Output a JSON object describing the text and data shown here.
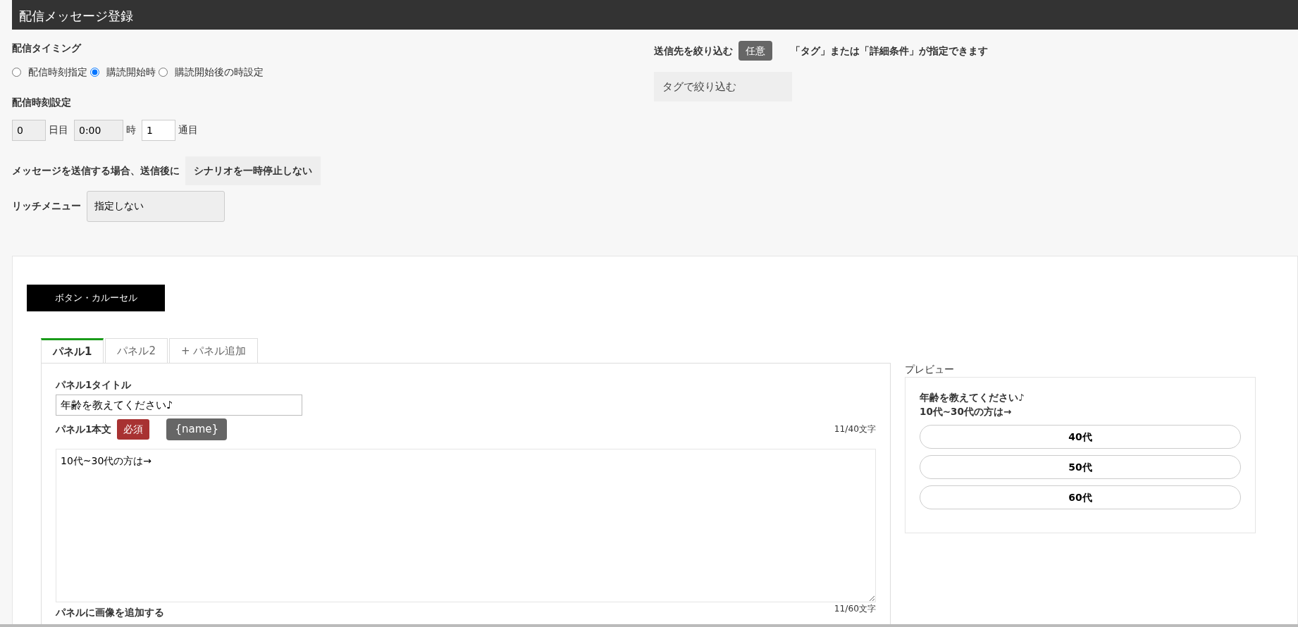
{
  "header": {
    "title": "配信メッセージ登録"
  },
  "timing": {
    "label": "配信タイミング",
    "options": [
      {
        "label": "配信時刻指定",
        "selected": false
      },
      {
        "label": "購読開始時",
        "selected": true
      },
      {
        "label": "購読開始後の時設定",
        "selected": false
      }
    ]
  },
  "schedule": {
    "label": "配信時刻設定",
    "fields": [
      {
        "value": "0",
        "disabled": true,
        "suffix": "日目"
      },
      {
        "value": "0:00",
        "disabled": true,
        "suffix": "時"
      },
      {
        "value": "1",
        "disabled": false,
        "suffix": "通目"
      }
    ]
  },
  "after_send": {
    "label": "メッセージを送信する場合、送信後に",
    "value": "シナリオを一時停止しない"
  },
  "rich_menu": {
    "label": "リッチメニュー",
    "value": "指定しない"
  },
  "filter": {
    "label": "送信先を絞り込む",
    "badge": "任意",
    "note": "「タグ」または「詳細条件」が指定できます",
    "tag_button": "タグで絞り込む"
  },
  "type_button": "ボタン・カルーセル",
  "tabs": [
    {
      "label": "パネル1",
      "selected": true
    },
    {
      "label": "パネル2",
      "selected": false
    },
    {
      "label": "+ パネル追加",
      "selected": false
    }
  ],
  "panel": {
    "title_label": "パネル1タイトル",
    "title_value": "年齢を教えてください♪",
    "title_count": "11/40文字",
    "body_label": "パネル1本文",
    "required_badge": "必須",
    "name_button": "{name}",
    "body_value": "10代~30代の方は→",
    "body_count": "11/60文字",
    "image_label": "パネルに画像を追加する"
  },
  "preview": {
    "label": "プレビュー",
    "title": "年齢を教えてください♪",
    "text": "10代~30代の方は→",
    "buttons": [
      "40代",
      "50代",
      "60代"
    ]
  }
}
